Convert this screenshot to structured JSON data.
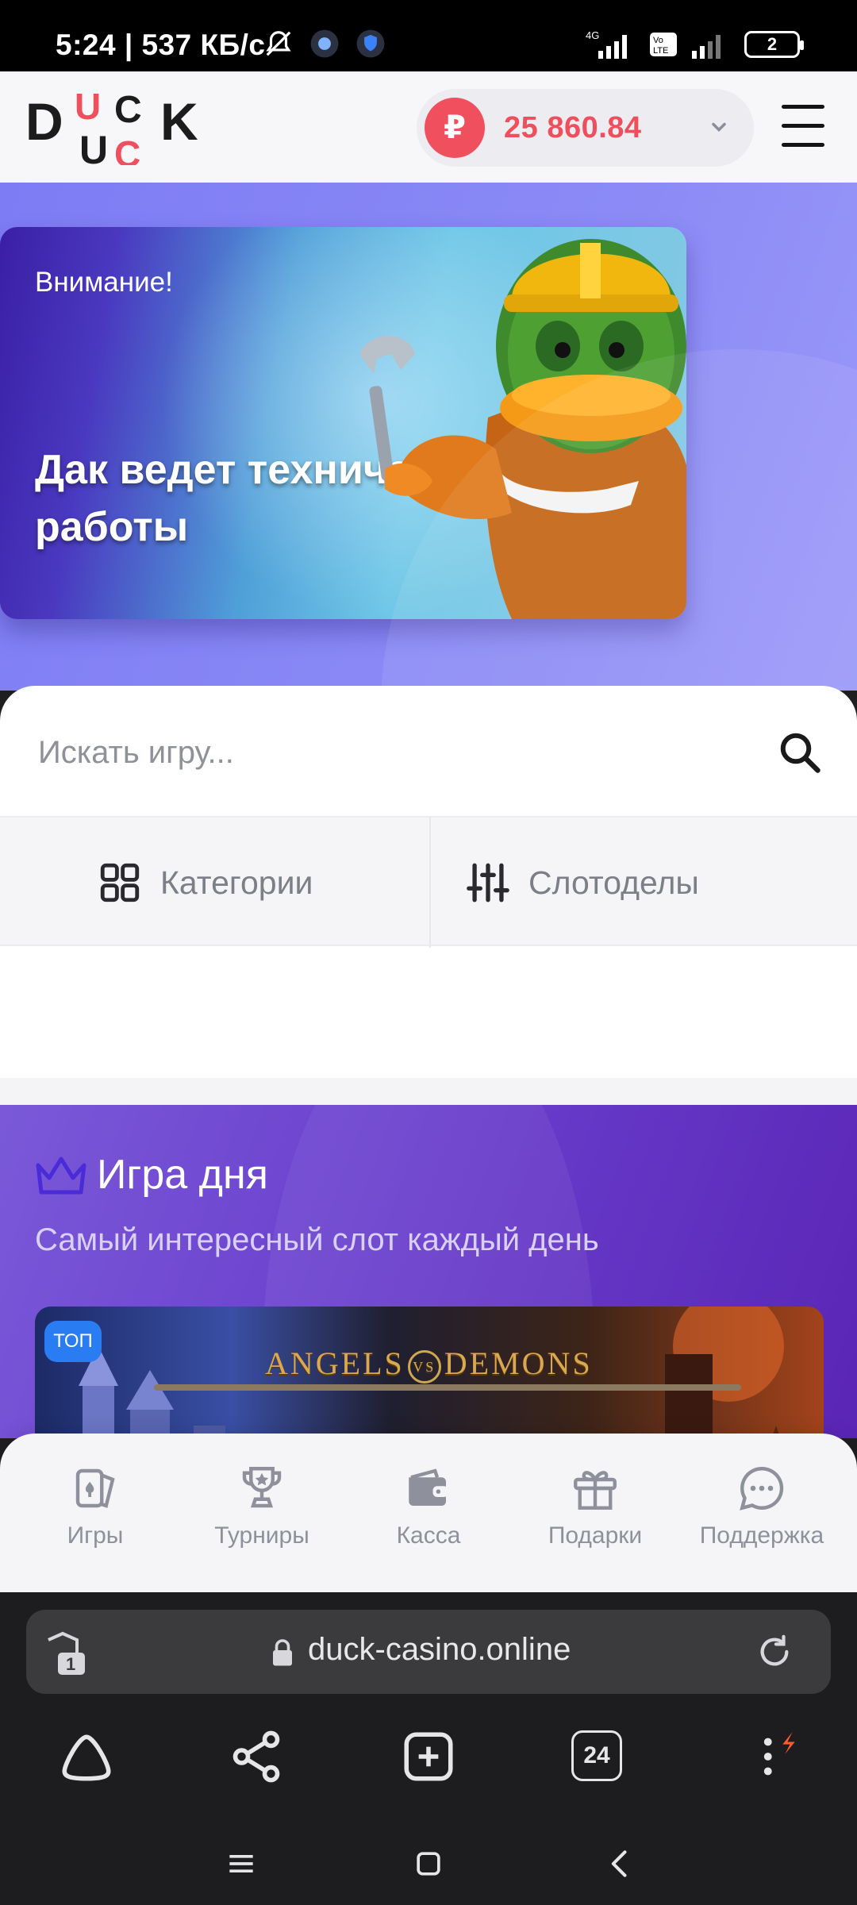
{
  "status_bar": {
    "time_speed": "5:24 | 537 КБ/с",
    "network_left": "4G",
    "volte": "Vo LTE",
    "battery": "2"
  },
  "header": {
    "logo_text": "DUCK",
    "balance_currency": "₽",
    "balance": "25 860.84"
  },
  "banner": {
    "kicker": "Внимание!",
    "title": "Дак ведет технические работы"
  },
  "search": {
    "placeholder": "Искать игру..."
  },
  "filters": {
    "categories": "Категории",
    "providers": "Слотоделы"
  },
  "game_of_day": {
    "title": "Игра дня",
    "subtitle": "Самый интересный слот каждый день",
    "badge": "ТОП",
    "game_logo_left": "ANGELS",
    "game_logo_vs": "VS",
    "game_logo_right": "DEMONS"
  },
  "site_nav": [
    {
      "label": "Игры",
      "icon": "cards-icon"
    },
    {
      "label": "Турниры",
      "icon": "trophy-icon"
    },
    {
      "label": "Касса",
      "icon": "wallet-icon"
    },
    {
      "label": "Подарки",
      "icon": "gift-icon"
    },
    {
      "label": "Поддержка",
      "icon": "chat-icon"
    }
  ],
  "browser": {
    "tab_count": "1",
    "url": "duck-casino.online",
    "tabs_counter": "24"
  },
  "colors": {
    "accent_red": "#ef4f5d",
    "promo_purple": "#8483f5",
    "gotd_purple": "#6a3fcd",
    "badge_blue": "#2a7cf2"
  }
}
